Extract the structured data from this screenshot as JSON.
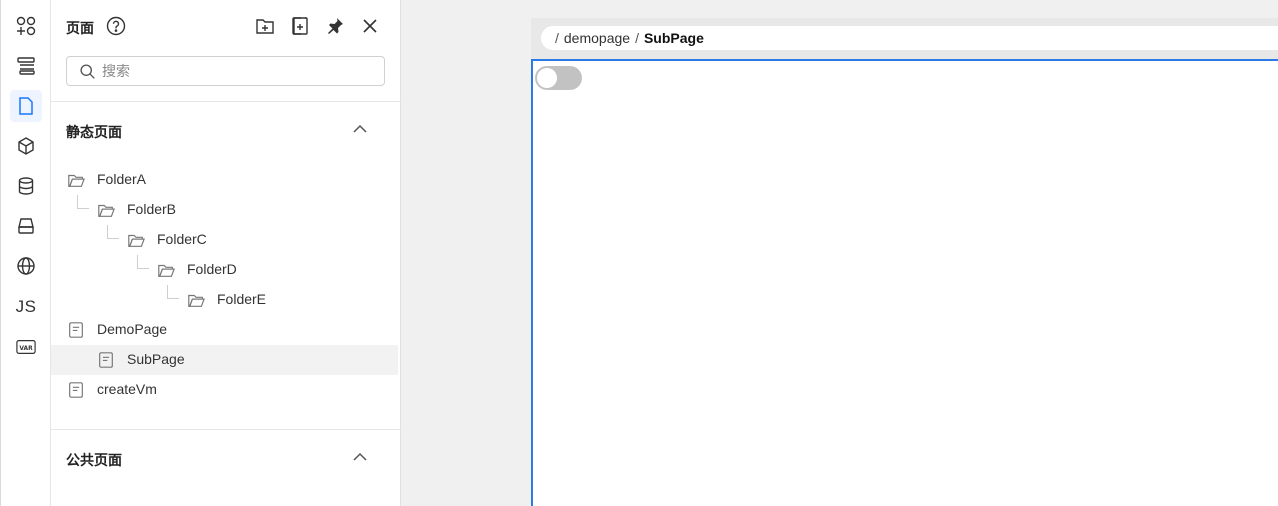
{
  "rail": {
    "items": [
      {
        "icon": "components-icon"
      },
      {
        "icon": "outline-icon"
      },
      {
        "icon": "page-icon",
        "active": true
      },
      {
        "icon": "cube-icon"
      },
      {
        "icon": "database-icon"
      },
      {
        "icon": "storage-icon"
      },
      {
        "icon": "globe-icon"
      },
      {
        "icon": "js-icon",
        "text": "JS"
      },
      {
        "icon": "var-icon",
        "text": "VAR"
      }
    ]
  },
  "panel": {
    "title": "页面",
    "search_placeholder": "搜索",
    "static_section": "静态页面",
    "public_section": "公共页面",
    "tree": [
      {
        "label": "FolderA",
        "type": "folder",
        "depth": 0
      },
      {
        "label": "FolderB",
        "type": "folder",
        "depth": 1
      },
      {
        "label": "FolderC",
        "type": "folder",
        "depth": 2
      },
      {
        "label": "FolderD",
        "type": "folder",
        "depth": 3
      },
      {
        "label": "FolderE",
        "type": "folder",
        "depth": 4
      },
      {
        "label": "DemoPage",
        "type": "page",
        "depth": 0
      },
      {
        "label": "SubPage",
        "type": "page",
        "depth": 1,
        "selected": true
      },
      {
        "label": "createVm",
        "type": "page",
        "depth": 0
      }
    ]
  },
  "breadcrumb": {
    "sep": "/",
    "parent": "demopage",
    "current": "SubPage"
  },
  "colors": {
    "accent": "#2b7be6",
    "active_bg": "#eef4ff"
  }
}
